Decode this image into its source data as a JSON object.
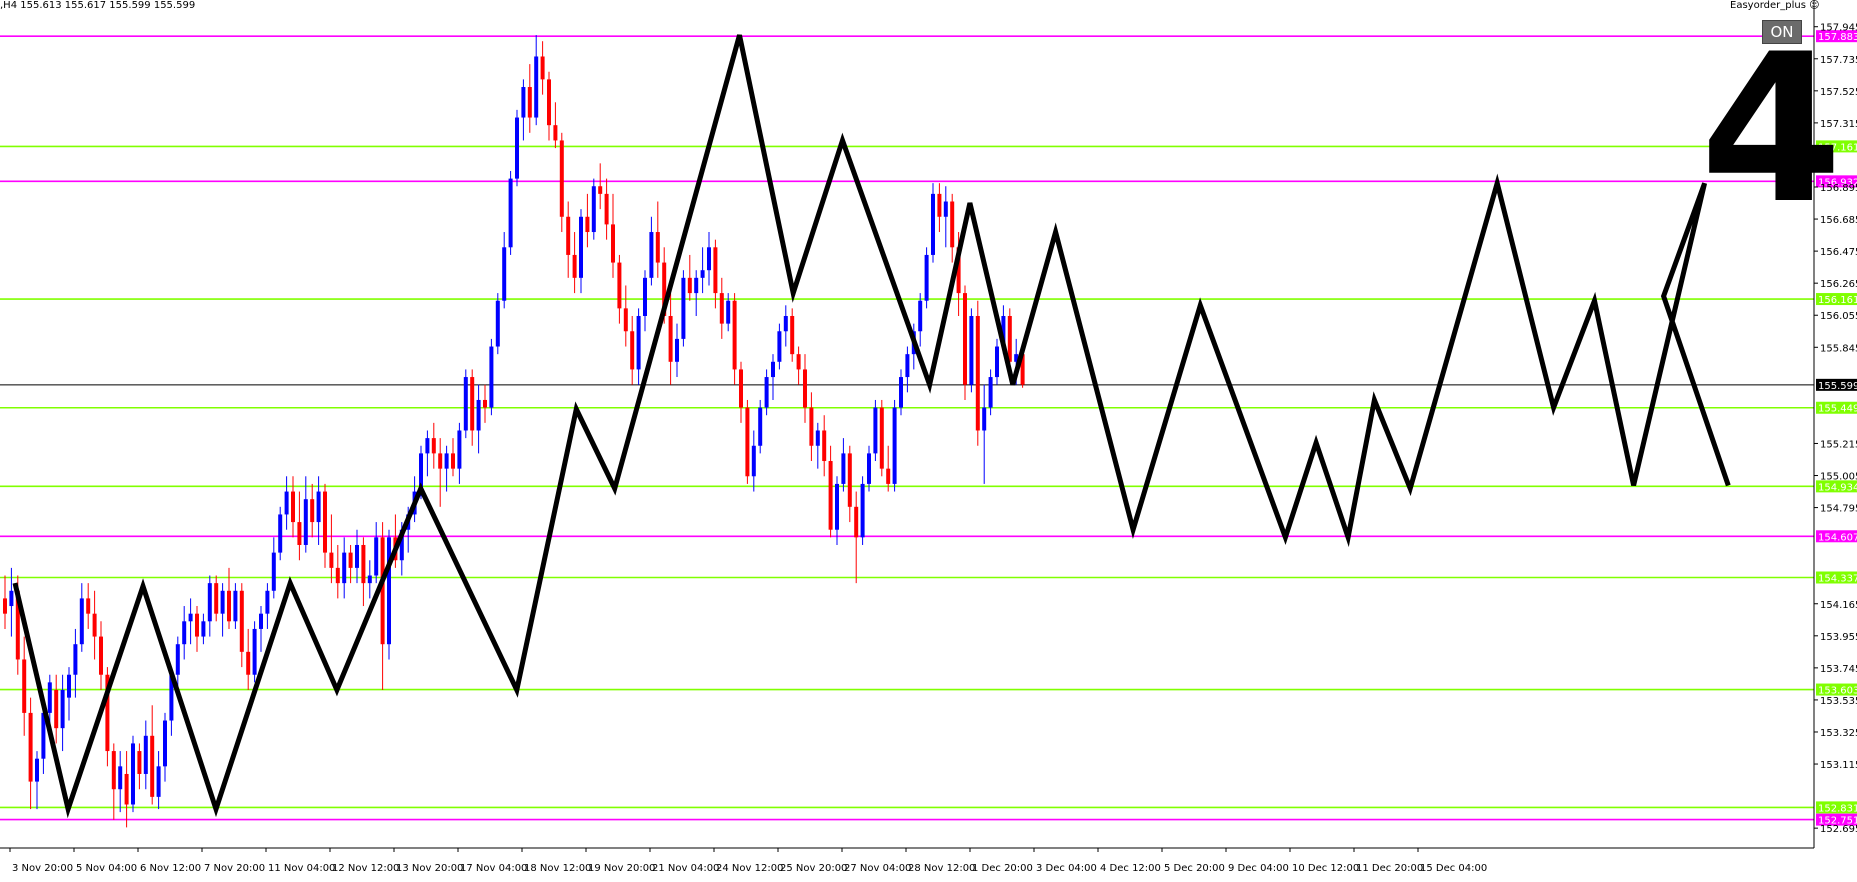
{
  "header": {
    "symbol_info": ",H4  155.613 155.617 155.599 155.599",
    "expert_name": "Easyorder_plus ☺"
  },
  "on_button_label": "ON",
  "big_number": "4",
  "colors": {
    "bull": "#0000ff",
    "bear": "#ff0000",
    "support_line": "#80ff00",
    "resistance_line": "#ff00ff",
    "zigzag": "#000000",
    "current_price_line": "#000000"
  },
  "chart_data": {
    "type": "candlestick",
    "timeframe": "H4",
    "ylim": [
      152.565,
      158.12
    ],
    "current_price": 155.599,
    "current_price_label": "155.599",
    "y_ticks": [
      "157.945",
      "157.735",
      "157.525",
      "157.315",
      "156.895",
      "156.685",
      "156.475",
      "156.265",
      "156.055",
      "155.845",
      "155.215",
      "155.005",
      "154.795",
      "154.165",
      "153.955",
      "153.745",
      "153.535",
      "153.325",
      "153.115",
      "152.695"
    ],
    "x_labels": [
      "3 Nov 20:00",
      "5 Nov 04:00",
      "6 Nov 12:00",
      "7 Nov 20:00",
      "11 Nov 04:00",
      "12 Nov 12:00",
      "13 Nov 20:00",
      "17 Nov 04:00",
      "18 Nov 12:00",
      "19 Nov 20:00",
      "21 Nov 04:00",
      "24 Nov 12:00",
      "25 Nov 20:00",
      "27 Nov 04:00",
      "28 Nov 12:00",
      "1 Dec 20:00",
      "3 Dec 04:00",
      "4 Dec 12:00",
      "5 Dec 20:00",
      "9 Dec 04:00",
      "10 Dec 12:00",
      "11 Dec 20:00",
      "15 Dec 04:00"
    ],
    "levels": [
      {
        "price": 157.883,
        "label": "157.883",
        "kind": "resistance"
      },
      {
        "price": 157.161,
        "label": "157.161",
        "kind": "support"
      },
      {
        "price": 156.932,
        "label": "156.932",
        "kind": "resistance"
      },
      {
        "price": 156.161,
        "label": "156.161",
        "kind": "support"
      },
      {
        "price": 155.449,
        "label": "155.449",
        "kind": "support"
      },
      {
        "price": 154.934,
        "label": "154.934",
        "kind": "support"
      },
      {
        "price": 154.607,
        "label": "154.607",
        "kind": "resistance"
      },
      {
        "price": 154.337,
        "label": "154.337",
        "kind": "support"
      },
      {
        "price": 153.603,
        "label": "153.603",
        "kind": "support"
      },
      {
        "price": 152.831,
        "label": "152.831",
        "kind": "support"
      },
      {
        "price": 152.751,
        "label": "152.751",
        "kind": "resistance"
      }
    ],
    "zigzag": [
      {
        "x": 0,
        "y": 154.3
      },
      {
        "x": 8.3,
        "y": 152.82
      },
      {
        "x": 20,
        "y": 154.28
      },
      {
        "x": 31.4,
        "y": 152.82
      },
      {
        "x": 43,
        "y": 154.3
      },
      {
        "x": 50.3,
        "y": 153.6
      },
      {
        "x": 63.4,
        "y": 154.92
      },
      {
        "x": 78.4,
        "y": 153.6
      },
      {
        "x": 87.7,
        "y": 155.44
      },
      {
        "x": 93.7,
        "y": 154.92
      },
      {
        "x": 113.2,
        "y": 157.89
      },
      {
        "x": 121.6,
        "y": 156.2
      },
      {
        "x": 129.3,
        "y": 157.2
      },
      {
        "x": 142.9,
        "y": 155.6
      },
      {
        "x": 149.2,
        "y": 156.79
      },
      {
        "x": 155.9,
        "y": 155.6
      },
      {
        "x": 162.6,
        "y": 156.6
      },
      {
        "x": 174.7,
        "y": 154.65
      },
      {
        "x": 185.2,
        "y": 156.12
      },
      {
        "x": 198.5,
        "y": 154.6
      },
      {
        "x": 203.3,
        "y": 155.22
      },
      {
        "x": 208.3,
        "y": 154.6
      },
      {
        "x": 212.4,
        "y": 155.5
      },
      {
        "x": 218,
        "y": 154.92
      },
      {
        "x": 231.6,
        "y": 156.92
      },
      {
        "x": 240.4,
        "y": 155.45
      },
      {
        "x": 246.8,
        "y": 156.15
      },
      {
        "x": 252.9,
        "y": 154.94
      },
      {
        "x": 264,
        "y": 156.92
      },
      {
        "x": 257.6,
        "y": 156.18
      },
      {
        "x": 267.7,
        "y": 154.94
      }
    ],
    "candles": [
      {
        "o": 154.2,
        "h": 154.35,
        "l": 154.0,
        "c": 154.1
      },
      {
        "o": 154.15,
        "h": 154.4,
        "l": 153.95,
        "c": 154.25
      },
      {
        "o": 154.25,
        "h": 154.35,
        "l": 153.7,
        "c": 153.8
      },
      {
        "o": 153.8,
        "h": 153.95,
        "l": 153.3,
        "c": 153.45
      },
      {
        "o": 153.45,
        "h": 153.55,
        "l": 152.82,
        "c": 153.0
      },
      {
        "o": 153.0,
        "h": 153.2,
        "l": 152.82,
        "c": 153.15
      },
      {
        "o": 153.15,
        "h": 153.55,
        "l": 153.05,
        "c": 153.45
      },
      {
        "o": 153.45,
        "h": 153.7,
        "l": 153.3,
        "c": 153.65
      },
      {
        "o": 153.6,
        "h": 153.7,
        "l": 153.25,
        "c": 153.35
      },
      {
        "o": 153.35,
        "h": 153.7,
        "l": 153.2,
        "c": 153.6
      },
      {
        "o": 153.55,
        "h": 153.75,
        "l": 153.4,
        "c": 153.7
      },
      {
        "o": 153.7,
        "h": 154.0,
        "l": 153.55,
        "c": 153.9
      },
      {
        "o": 153.9,
        "h": 154.3,
        "l": 153.85,
        "c": 154.2
      },
      {
        "o": 154.2,
        "h": 154.3,
        "l": 154.0,
        "c": 154.1
      },
      {
        "o": 154.1,
        "h": 154.25,
        "l": 153.8,
        "c": 153.95
      },
      {
        "o": 153.95,
        "h": 154.05,
        "l": 153.6,
        "c": 153.7
      },
      {
        "o": 153.7,
        "h": 153.75,
        "l": 153.1,
        "c": 153.2
      },
      {
        "o": 153.2,
        "h": 153.25,
        "l": 152.75,
        "c": 152.95
      },
      {
        "o": 152.95,
        "h": 153.2,
        "l": 152.8,
        "c": 153.1
      },
      {
        "o": 153.05,
        "h": 153.2,
        "l": 152.7,
        "c": 152.85
      },
      {
        "o": 152.85,
        "h": 153.3,
        "l": 152.8,
        "c": 153.25
      },
      {
        "o": 153.2,
        "h": 153.25,
        "l": 152.95,
        "c": 153.05
      },
      {
        "o": 153.05,
        "h": 153.4,
        "l": 152.95,
        "c": 153.3
      },
      {
        "o": 153.3,
        "h": 153.5,
        "l": 152.85,
        "c": 152.9
      },
      {
        "o": 152.9,
        "h": 153.2,
        "l": 152.82,
        "c": 153.1
      },
      {
        "o": 153.1,
        "h": 153.45,
        "l": 153.0,
        "c": 153.4
      },
      {
        "o": 153.4,
        "h": 153.75,
        "l": 153.3,
        "c": 153.7
      },
      {
        "o": 153.7,
        "h": 153.95,
        "l": 153.6,
        "c": 153.9
      },
      {
        "o": 153.9,
        "h": 154.15,
        "l": 153.8,
        "c": 154.05
      },
      {
        "o": 154.05,
        "h": 154.2,
        "l": 153.9,
        "c": 154.1
      },
      {
        "o": 154.1,
        "h": 154.15,
        "l": 153.85,
        "c": 153.95
      },
      {
        "o": 153.95,
        "h": 154.1,
        "l": 153.9,
        "c": 154.05
      },
      {
        "o": 154.05,
        "h": 154.35,
        "l": 153.95,
        "c": 154.3
      },
      {
        "o": 154.3,
        "h": 154.35,
        "l": 154.05,
        "c": 154.1
      },
      {
        "o": 154.1,
        "h": 154.3,
        "l": 153.95,
        "c": 154.25
      },
      {
        "o": 154.25,
        "h": 154.4,
        "l": 154.0,
        "c": 154.05
      },
      {
        "o": 154.05,
        "h": 154.3,
        "l": 154.0,
        "c": 154.25
      },
      {
        "o": 154.25,
        "h": 154.3,
        "l": 153.75,
        "c": 153.85
      },
      {
        "o": 153.85,
        "h": 154.0,
        "l": 153.6,
        "c": 153.7
      },
      {
        "o": 153.7,
        "h": 154.05,
        "l": 153.65,
        "c": 154.0
      },
      {
        "o": 154.0,
        "h": 154.15,
        "l": 153.85,
        "c": 154.1
      },
      {
        "o": 154.1,
        "h": 154.3,
        "l": 154.0,
        "c": 154.25
      },
      {
        "o": 154.25,
        "h": 154.6,
        "l": 154.2,
        "c": 154.5
      },
      {
        "o": 154.5,
        "h": 154.8,
        "l": 154.45,
        "c": 154.75
      },
      {
        "o": 154.75,
        "h": 155.0,
        "l": 154.65,
        "c": 154.9
      },
      {
        "o": 154.9,
        "h": 155.0,
        "l": 154.6,
        "c": 154.7
      },
      {
        "o": 154.7,
        "h": 154.9,
        "l": 154.45,
        "c": 154.55
      },
      {
        "o": 154.55,
        "h": 155.0,
        "l": 154.5,
        "c": 154.85
      },
      {
        "o": 154.85,
        "h": 154.95,
        "l": 154.6,
        "c": 154.7
      },
      {
        "o": 154.7,
        "h": 155.0,
        "l": 154.55,
        "c": 154.9
      },
      {
        "o": 154.9,
        "h": 154.95,
        "l": 154.4,
        "c": 154.5
      },
      {
        "o": 154.5,
        "h": 154.75,
        "l": 154.3,
        "c": 154.4
      },
      {
        "o": 154.4,
        "h": 154.55,
        "l": 154.2,
        "c": 154.3
      },
      {
        "o": 154.3,
        "h": 154.6,
        "l": 154.2,
        "c": 154.5
      },
      {
        "o": 154.5,
        "h": 154.55,
        "l": 154.3,
        "c": 154.4
      },
      {
        "o": 154.4,
        "h": 154.65,
        "l": 154.3,
        "c": 154.55
      },
      {
        "o": 154.55,
        "h": 154.6,
        "l": 154.15,
        "c": 154.3
      },
      {
        "o": 154.3,
        "h": 154.45,
        "l": 154.2,
        "c": 154.35
      },
      {
        "o": 154.35,
        "h": 154.7,
        "l": 154.3,
        "c": 154.6
      },
      {
        "o": 154.6,
        "h": 154.7,
        "l": 153.6,
        "c": 153.9
      },
      {
        "o": 153.9,
        "h": 154.65,
        "l": 153.8,
        "c": 154.6
      },
      {
        "o": 154.6,
        "h": 154.75,
        "l": 154.4,
        "c": 154.45
      },
      {
        "o": 154.45,
        "h": 154.7,
        "l": 154.35,
        "c": 154.65
      },
      {
        "o": 154.65,
        "h": 154.8,
        "l": 154.5,
        "c": 154.75
      },
      {
        "o": 154.75,
        "h": 155.0,
        "l": 154.7,
        "c": 154.9
      },
      {
        "o": 154.9,
        "h": 155.2,
        "l": 154.85,
        "c": 155.15
      },
      {
        "o": 155.15,
        "h": 155.3,
        "l": 155.0,
        "c": 155.25
      },
      {
        "o": 155.25,
        "h": 155.35,
        "l": 155.05,
        "c": 155.15
      },
      {
        "o": 155.15,
        "h": 155.25,
        "l": 154.8,
        "c": 155.05
      },
      {
        "o": 155.05,
        "h": 155.2,
        "l": 154.9,
        "c": 155.15
      },
      {
        "o": 155.15,
        "h": 155.25,
        "l": 155.0,
        "c": 155.05
      },
      {
        "o": 155.05,
        "h": 155.35,
        "l": 154.95,
        "c": 155.3
      },
      {
        "o": 155.3,
        "h": 155.7,
        "l": 155.25,
        "c": 155.65
      },
      {
        "o": 155.65,
        "h": 155.7,
        "l": 155.2,
        "c": 155.3
      },
      {
        "o": 155.3,
        "h": 155.6,
        "l": 155.15,
        "c": 155.5
      },
      {
        "o": 155.5,
        "h": 155.6,
        "l": 155.35,
        "c": 155.45
      },
      {
        "o": 155.45,
        "h": 155.9,
        "l": 155.4,
        "c": 155.85
      },
      {
        "o": 155.85,
        "h": 156.2,
        "l": 155.8,
        "c": 156.15
      },
      {
        "o": 156.15,
        "h": 156.6,
        "l": 156.1,
        "c": 156.5
      },
      {
        "o": 156.5,
        "h": 157.0,
        "l": 156.45,
        "c": 156.95
      },
      {
        "o": 156.95,
        "h": 157.4,
        "l": 156.9,
        "c": 157.35
      },
      {
        "o": 157.35,
        "h": 157.6,
        "l": 157.2,
        "c": 157.55
      },
      {
        "o": 157.55,
        "h": 157.7,
        "l": 157.25,
        "c": 157.35
      },
      {
        "o": 157.35,
        "h": 157.89,
        "l": 157.3,
        "c": 157.75
      },
      {
        "o": 157.75,
        "h": 157.85,
        "l": 157.5,
        "c": 157.6
      },
      {
        "o": 157.6,
        "h": 157.65,
        "l": 157.2,
        "c": 157.3
      },
      {
        "o": 157.3,
        "h": 157.45,
        "l": 157.15,
        "c": 157.2
      },
      {
        "o": 157.2,
        "h": 157.25,
        "l": 156.6,
        "c": 156.7
      },
      {
        "o": 156.7,
        "h": 156.8,
        "l": 156.3,
        "c": 156.45
      },
      {
        "o": 156.45,
        "h": 156.6,
        "l": 156.2,
        "c": 156.3
      },
      {
        "o": 156.3,
        "h": 156.75,
        "l": 156.2,
        "c": 156.7
      },
      {
        "o": 156.7,
        "h": 156.85,
        "l": 156.5,
        "c": 156.6
      },
      {
        "o": 156.6,
        "h": 156.95,
        "l": 156.55,
        "c": 156.9
      },
      {
        "o": 156.9,
        "h": 157.05,
        "l": 156.75,
        "c": 156.85
      },
      {
        "o": 156.85,
        "h": 156.95,
        "l": 156.55,
        "c": 156.65
      },
      {
        "o": 156.65,
        "h": 156.85,
        "l": 156.3,
        "c": 156.4
      },
      {
        "o": 156.4,
        "h": 156.45,
        "l": 156.0,
        "c": 156.1
      },
      {
        "o": 156.1,
        "h": 156.25,
        "l": 155.85,
        "c": 155.95
      },
      {
        "o": 155.95,
        "h": 156.05,
        "l": 155.6,
        "c": 155.7
      },
      {
        "o": 155.7,
        "h": 156.1,
        "l": 155.6,
        "c": 156.05
      },
      {
        "o": 156.05,
        "h": 156.35,
        "l": 155.95,
        "c": 156.3
      },
      {
        "o": 156.3,
        "h": 156.7,
        "l": 156.25,
        "c": 156.6
      },
      {
        "o": 156.6,
        "h": 156.8,
        "l": 156.3,
        "c": 156.4
      },
      {
        "o": 156.4,
        "h": 156.5,
        "l": 156.0,
        "c": 156.05
      },
      {
        "o": 156.05,
        "h": 156.2,
        "l": 155.6,
        "c": 155.75
      },
      {
        "o": 155.75,
        "h": 156.0,
        "l": 155.65,
        "c": 155.9
      },
      {
        "o": 155.9,
        "h": 156.35,
        "l": 155.85,
        "c": 156.3
      },
      {
        "o": 156.3,
        "h": 156.45,
        "l": 156.15,
        "c": 156.2
      },
      {
        "o": 156.2,
        "h": 156.35,
        "l": 156.05,
        "c": 156.3
      },
      {
        "o": 156.3,
        "h": 156.5,
        "l": 156.2,
        "c": 156.35
      },
      {
        "o": 156.35,
        "h": 156.6,
        "l": 156.25,
        "c": 156.5
      },
      {
        "o": 156.5,
        "h": 156.55,
        "l": 156.1,
        "c": 156.2
      },
      {
        "o": 156.2,
        "h": 156.3,
        "l": 155.9,
        "c": 156.0
      },
      {
        "o": 156.0,
        "h": 156.2,
        "l": 155.95,
        "c": 156.15
      },
      {
        "o": 156.15,
        "h": 156.2,
        "l": 155.6,
        "c": 155.7
      },
      {
        "o": 155.7,
        "h": 155.75,
        "l": 155.35,
        "c": 155.45
      },
      {
        "o": 155.45,
        "h": 155.5,
        "l": 154.95,
        "c": 155.0
      },
      {
        "o": 155.0,
        "h": 155.3,
        "l": 154.9,
        "c": 155.2
      },
      {
        "o": 155.2,
        "h": 155.5,
        "l": 155.15,
        "c": 155.45
      },
      {
        "o": 155.45,
        "h": 155.7,
        "l": 155.4,
        "c": 155.65
      },
      {
        "o": 155.65,
        "h": 155.8,
        "l": 155.5,
        "c": 155.75
      },
      {
        "o": 155.75,
        "h": 156.0,
        "l": 155.7,
        "c": 155.95
      },
      {
        "o": 155.95,
        "h": 156.12,
        "l": 155.85,
        "c": 156.05
      },
      {
        "o": 156.05,
        "h": 156.1,
        "l": 155.75,
        "c": 155.8
      },
      {
        "o": 155.8,
        "h": 155.85,
        "l": 155.6,
        "c": 155.7
      },
      {
        "o": 155.7,
        "h": 155.8,
        "l": 155.35,
        "c": 155.45
      },
      {
        "o": 155.45,
        "h": 155.55,
        "l": 155.1,
        "c": 155.2
      },
      {
        "o": 155.2,
        "h": 155.35,
        "l": 155.05,
        "c": 155.3
      },
      {
        "o": 155.3,
        "h": 155.4,
        "l": 155.0,
        "c": 155.1
      },
      {
        "o": 155.1,
        "h": 155.2,
        "l": 154.6,
        "c": 154.65
      },
      {
        "o": 154.65,
        "h": 155.0,
        "l": 154.55,
        "c": 154.95
      },
      {
        "o": 154.95,
        "h": 155.25,
        "l": 154.9,
        "c": 155.15
      },
      {
        "o": 155.15,
        "h": 155.2,
        "l": 154.7,
        "c": 154.8
      },
      {
        "o": 154.8,
        "h": 154.9,
        "l": 154.3,
        "c": 154.6
      },
      {
        "o": 154.6,
        "h": 155.0,
        "l": 154.55,
        "c": 154.95
      },
      {
        "o": 154.95,
        "h": 155.2,
        "l": 154.9,
        "c": 155.15
      },
      {
        "o": 155.15,
        "h": 155.5,
        "l": 155.1,
        "c": 155.45
      },
      {
        "o": 155.45,
        "h": 155.5,
        "l": 155.0,
        "c": 155.05
      },
      {
        "o": 155.05,
        "h": 155.2,
        "l": 154.9,
        "c": 154.95
      },
      {
        "o": 154.95,
        "h": 155.5,
        "l": 154.9,
        "c": 155.45
      },
      {
        "o": 155.45,
        "h": 155.7,
        "l": 155.4,
        "c": 155.65
      },
      {
        "o": 155.65,
        "h": 155.85,
        "l": 155.55,
        "c": 155.8
      },
      {
        "o": 155.8,
        "h": 156.0,
        "l": 155.7,
        "c": 155.95
      },
      {
        "o": 155.95,
        "h": 156.2,
        "l": 155.85,
        "c": 156.15
      },
      {
        "o": 156.15,
        "h": 156.5,
        "l": 156.1,
        "c": 156.45
      },
      {
        "o": 156.45,
        "h": 156.92,
        "l": 156.4,
        "c": 156.85
      },
      {
        "o": 156.85,
        "h": 156.92,
        "l": 156.6,
        "c": 156.7
      },
      {
        "o": 156.7,
        "h": 156.9,
        "l": 156.5,
        "c": 156.8
      },
      {
        "o": 156.8,
        "h": 156.85,
        "l": 156.4,
        "c": 156.5
      },
      {
        "o": 156.5,
        "h": 156.6,
        "l": 156.05,
        "c": 156.2
      },
      {
        "o": 156.2,
        "h": 156.25,
        "l": 155.5,
        "c": 155.6
      },
      {
        "o": 155.6,
        "h": 156.1,
        "l": 155.55,
        "c": 156.05
      },
      {
        "o": 156.05,
        "h": 156.15,
        "l": 155.2,
        "c": 155.3
      },
      {
        "o": 155.3,
        "h": 155.6,
        "l": 154.95,
        "c": 155.45
      },
      {
        "o": 155.45,
        "h": 155.7,
        "l": 155.4,
        "c": 155.65
      },
      {
        "o": 155.65,
        "h": 155.9,
        "l": 155.6,
        "c": 155.85
      },
      {
        "o": 155.85,
        "h": 156.12,
        "l": 155.8,
        "c": 156.05
      },
      {
        "o": 156.05,
        "h": 156.1,
        "l": 155.65,
        "c": 155.75
      },
      {
        "o": 155.75,
        "h": 155.9,
        "l": 155.6,
        "c": 155.8
      },
      {
        "o": 155.8,
        "h": 155.85,
        "l": 155.58,
        "c": 155.6
      }
    ]
  }
}
